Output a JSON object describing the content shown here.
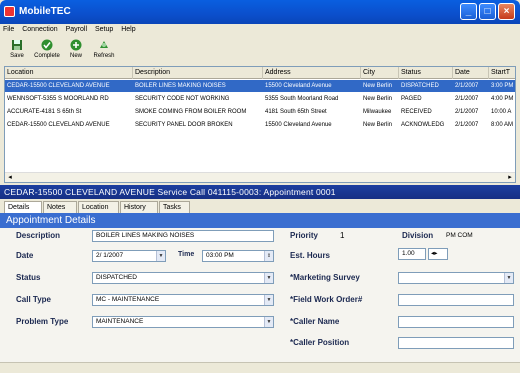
{
  "window": {
    "title": "MobileTEC"
  },
  "menu": [
    "File",
    "Connection",
    "Payroll",
    "Setup",
    "Help"
  ],
  "toolbar": {
    "save_label": "Save",
    "complete_label": "Complete",
    "new_label": "New",
    "refresh_label": "Refresh"
  },
  "grid": {
    "headers": [
      "Location",
      "Description",
      "Address",
      "City",
      "Status",
      "Date",
      "StartT"
    ],
    "rows": [
      [
        "CEDAR-15500 CLEVELAND AVENUE",
        "BOILER LINES MAKING NOISES",
        "15500 Cleveland Avenue",
        "New Berlin",
        "DISPATCHED",
        "2/1/2007",
        "3:00 PM"
      ],
      [
        "WENNSOFT-5355 S MOORLAND RD",
        "SECURITY CODE NOT WORKING",
        "5355 South Moorland Road",
        "New Berlin",
        "PAGED",
        "2/1/2007",
        "4:00 PM"
      ],
      [
        "ACCURATE-4181 S 65th St",
        "SMOKE COMING FROM BOILER ROOM",
        "4181 South 65th Street",
        "Milwaukee",
        "RECEIVED",
        "2/1/2007",
        "10:00 A"
      ],
      [
        "CEDAR-15500 CLEVELAND AVENUE",
        "SECURITY PANEL DOOR BROKEN",
        "15500 Cleveland Avenue",
        "New Berlin",
        "ACKNOWLEDG",
        "2/1/2007",
        "8:00 AM"
      ]
    ]
  },
  "detail": {
    "title": "CEDAR-15500 CLEVELAND AVENUE Service Call 041115-0003: Appointment 0001",
    "tabs": [
      "Details",
      "Notes",
      "Location",
      "History",
      "Tasks"
    ],
    "section": "Appointment Details",
    "labels": {
      "description": "Description",
      "date": "Date",
      "time": "Time",
      "status": "Status",
      "call_type": "Call Type",
      "problem_type": "Problem Type",
      "priority": "Priority",
      "division": "Division",
      "est_hours": "Est. Hours",
      "marketing_survey": "*Marketing Survey",
      "field_work_order": "*Field Work Order#",
      "caller_name": "*Caller Name",
      "caller_position": "*Caller Position"
    },
    "values": {
      "description": "BOILER LINES MAKING NOISES",
      "date": "2/ 1/2007",
      "time": "03:00 PM",
      "status": "DISPATCHED",
      "call_type": "MC - MAINTENANCE",
      "problem_type": "MAINTENANCE",
      "priority": "1",
      "division": "PM COM",
      "est_hours": "1.00",
      "marketing_survey": "",
      "field_work_order": "",
      "caller_name": "",
      "caller_position": ""
    }
  }
}
